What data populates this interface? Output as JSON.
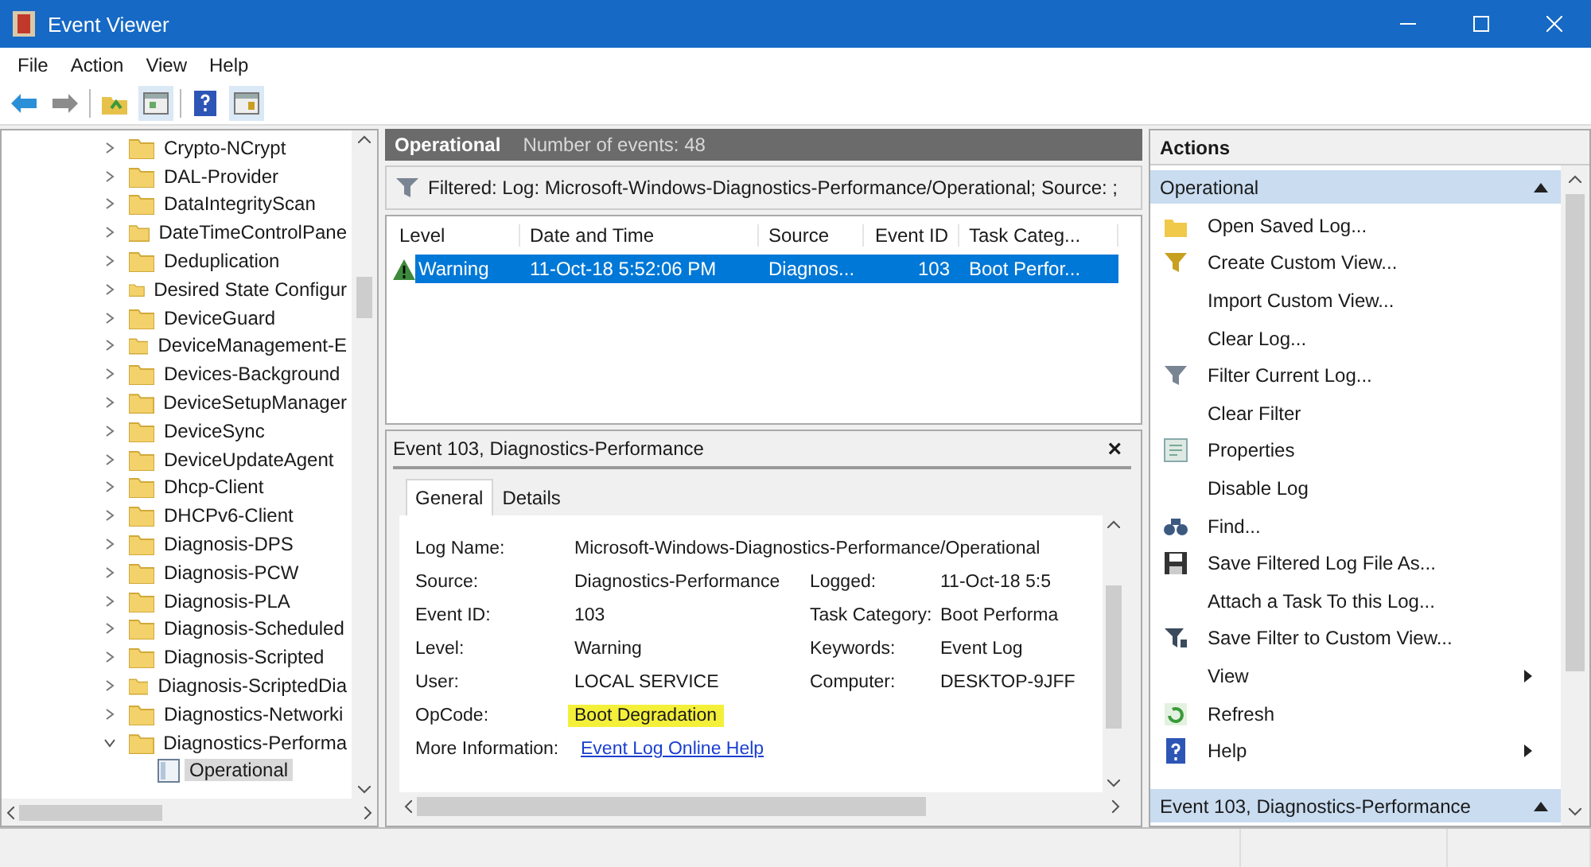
{
  "window": {
    "title": "Event Viewer"
  },
  "menu": [
    "File",
    "Action",
    "View",
    "Help"
  ],
  "tree": {
    "items": [
      {
        "label": "Crypto-NCrypt",
        "expanded": false
      },
      {
        "label": "DAL-Provider",
        "expanded": false
      },
      {
        "label": "DataIntegrityScan",
        "expanded": false
      },
      {
        "label": "DateTimeControlPane",
        "expanded": false
      },
      {
        "label": "Deduplication",
        "expanded": false
      },
      {
        "label": "Desired State Configur",
        "expanded": false
      },
      {
        "label": "DeviceGuard",
        "expanded": false
      },
      {
        "label": "DeviceManagement-E",
        "expanded": false
      },
      {
        "label": "Devices-Background",
        "expanded": false
      },
      {
        "label": "DeviceSetupManager",
        "expanded": false
      },
      {
        "label": "DeviceSync",
        "expanded": false
      },
      {
        "label": "DeviceUpdateAgent",
        "expanded": false
      },
      {
        "label": "Dhcp-Client",
        "expanded": false
      },
      {
        "label": "DHCPv6-Client",
        "expanded": false
      },
      {
        "label": "Diagnosis-DPS",
        "expanded": false
      },
      {
        "label": "Diagnosis-PCW",
        "expanded": false
      },
      {
        "label": "Diagnosis-PLA",
        "expanded": false
      },
      {
        "label": "Diagnosis-Scheduled",
        "expanded": false
      },
      {
        "label": "Diagnosis-Scripted",
        "expanded": false
      },
      {
        "label": "Diagnosis-ScriptedDia",
        "expanded": false
      },
      {
        "label": "Diagnostics-Networki",
        "expanded": false
      },
      {
        "label": "Diagnostics-Performa",
        "expanded": true,
        "children": [
          {
            "label": "Operational",
            "selected": true
          }
        ]
      }
    ]
  },
  "log": {
    "title": "Operational",
    "count": "Number of events: 48",
    "filter": "Filtered: Log: Microsoft-Windows-Diagnostics-Performance/Operational; Source: ;",
    "columns": [
      "Level",
      "Date and Time",
      "Source",
      "Event ID",
      "Task Categ..."
    ],
    "rows": [
      {
        "selected": true,
        "cells": [
          "Warning",
          "11-Oct-18 5:52:06 PM",
          "Diagnos...",
          "103",
          "Boot Perfor..."
        ]
      }
    ]
  },
  "detail": {
    "title": "Event 103, Diagnostics-Performance",
    "close": "×",
    "tabs": [
      {
        "label": "General",
        "selected": true
      },
      {
        "label": "Details",
        "selected": false
      }
    ],
    "fields": [
      {
        "label": "Log Name:",
        "value": "Microsoft-Windows-Diagnostics-Performance/Operational"
      },
      {
        "label": "Source:",
        "value": "Diagnostics-Performance",
        "label2": "Logged:",
        "value2": "11-Oct-18 5:5"
      },
      {
        "label": "Event ID:",
        "value": "103",
        "label2": "Task Category:",
        "value2": "Boot Performa"
      },
      {
        "label": "Level:",
        "value": "Warning",
        "label2": "Keywords:",
        "value2": "Event Log"
      },
      {
        "label": "User:",
        "value": "LOCAL SERVICE",
        "label2": "Computer:",
        "value2": "DESKTOP-9JFF"
      },
      {
        "label": "OpCode:",
        "value": "Boot Degradation",
        "highlighted": true
      },
      {
        "label": "More Information:",
        "value": "Event Log Online Help",
        "kind": "link"
      }
    ]
  },
  "actions": {
    "title": "Actions",
    "sections": [
      {
        "title": "Operational",
        "expanded": true,
        "items": [
          {
            "label": "Open Saved Log...",
            "kind": "open",
            "submenu": false
          },
          {
            "label": "Create Custom View...",
            "kind": "funnel",
            "submenu": false
          },
          {
            "label": "Import Custom View...",
            "kind": "none",
            "submenu": false
          },
          {
            "label": "Clear Log...",
            "kind": "none",
            "submenu": false
          },
          {
            "label": "Filter Current Log...",
            "kind": "funnel-gray",
            "submenu": false
          },
          {
            "label": "Clear Filter",
            "kind": "none",
            "submenu": false
          },
          {
            "label": "Properties",
            "kind": "properties",
            "submenu": false
          },
          {
            "label": "Disable Log",
            "kind": "none",
            "submenu": false
          },
          {
            "label": "Find...",
            "kind": "find",
            "submenu": false
          },
          {
            "label": "Save Filtered Log File As...",
            "kind": "save",
            "submenu": false
          },
          {
            "label": "Attach a Task To this Log...",
            "kind": "none",
            "submenu": false
          },
          {
            "label": "Save Filter to Custom View...",
            "kind": "save-filter",
            "submenu": false
          },
          {
            "label": "View",
            "kind": "none",
            "submenu": true
          },
          {
            "label": "Refresh",
            "kind": "refresh",
            "submenu": false
          },
          {
            "label": "Help",
            "kind": "help",
            "submenu": true
          }
        ]
      },
      {
        "title": "Event 103, Diagnostics-Performance",
        "expanded": true
      }
    ]
  }
}
